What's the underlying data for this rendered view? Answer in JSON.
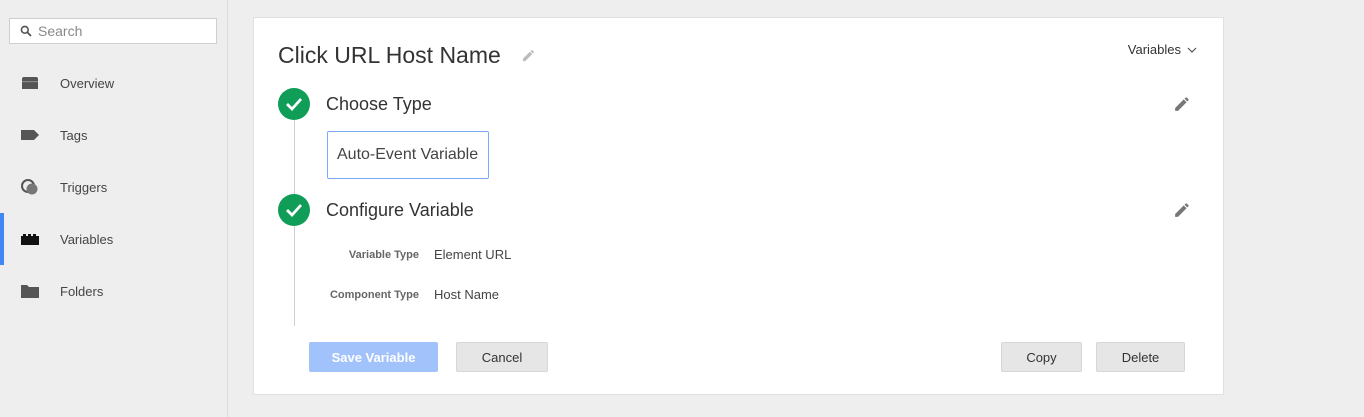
{
  "sidebar": {
    "search_placeholder": "Search",
    "items": [
      {
        "label": "Overview",
        "icon": "overview-icon",
        "active": false
      },
      {
        "label": "Tags",
        "icon": "tag-icon",
        "active": false
      },
      {
        "label": "Triggers",
        "icon": "triggers-icon",
        "active": false
      },
      {
        "label": "Variables",
        "icon": "variables-icon",
        "active": true
      },
      {
        "label": "Folders",
        "icon": "folder-icon",
        "active": false
      }
    ]
  },
  "editor": {
    "title": "Click URL Host Name",
    "variables_menu_label": "Variables",
    "steps": [
      {
        "title": "Choose Type",
        "selected_type": "Auto-Event Variable"
      },
      {
        "title": "Configure Variable",
        "properties": [
          {
            "label": "Variable Type",
            "value": "Element URL"
          },
          {
            "label": "Component Type",
            "value": "Host Name"
          }
        ]
      }
    ],
    "buttons": {
      "save": "Save Variable",
      "cancel": "Cancel",
      "copy": "Copy",
      "delete": "Delete"
    }
  },
  "colors": {
    "accent": "#4285f4",
    "success": "#0f9d58",
    "save_disabled": "#a1c2fa"
  }
}
